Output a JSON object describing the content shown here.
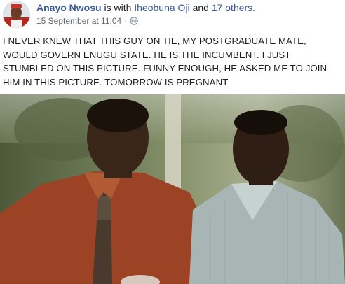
{
  "post": {
    "author": "Anayo Nwosu",
    "with_text": "is with",
    "tagged_person": "Iheobuna Oji",
    "connector": "and",
    "others": "17 others.",
    "date": "15 September at 11:04",
    "separator": "·",
    "privacy_icon": "globe-icon",
    "text": "I NEVER KNEW THAT THIS GUY ON TIE, MY POSTGRADUATE MATE, WOULD GOVERN ENUGU STATE. HE IS THE INCUMBENT. I JUST STUMBLED ON THIS PICTURE. FUNNY ENOUGH, HE ASKED ME TO JOIN HIM IN THIS PICTURE. TOMORROW IS PREGNANT"
  },
  "colors": {
    "link": "#385898",
    "meta": "#616770",
    "text": "#1c1e21"
  }
}
